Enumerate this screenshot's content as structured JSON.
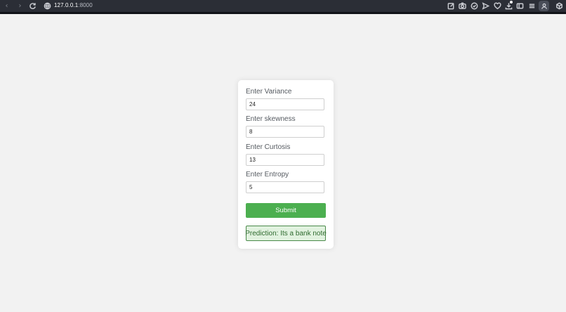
{
  "browser": {
    "url_host": "127.0.0.1",
    "url_port": ":8000",
    "icons": [
      "back-icon",
      "forward-icon",
      "reload-icon",
      "site-info-icon",
      "edit-icon",
      "camera-icon",
      "shield-check-icon",
      "send-icon",
      "heart-icon",
      "download-icon",
      "sidebar-icon",
      "menu-icon",
      "profile-icon",
      "extensions-icon"
    ]
  },
  "form": {
    "fields": [
      {
        "label": "Enter Variance",
        "value": "24"
      },
      {
        "label": "Enter skewness",
        "value": "8"
      },
      {
        "label": "Enter Curtosis",
        "value": "13"
      },
      {
        "label": "Enter Entropy",
        "value": "5"
      }
    ],
    "submit_label": "Submit",
    "prediction_text": "Prediction: Its a bank note"
  },
  "colors": {
    "submit_bg": "#4caf50",
    "prediction_bg": "#e1f2df",
    "prediction_border": "#4a8a4a",
    "topbar_bg": "#2b2e36"
  }
}
